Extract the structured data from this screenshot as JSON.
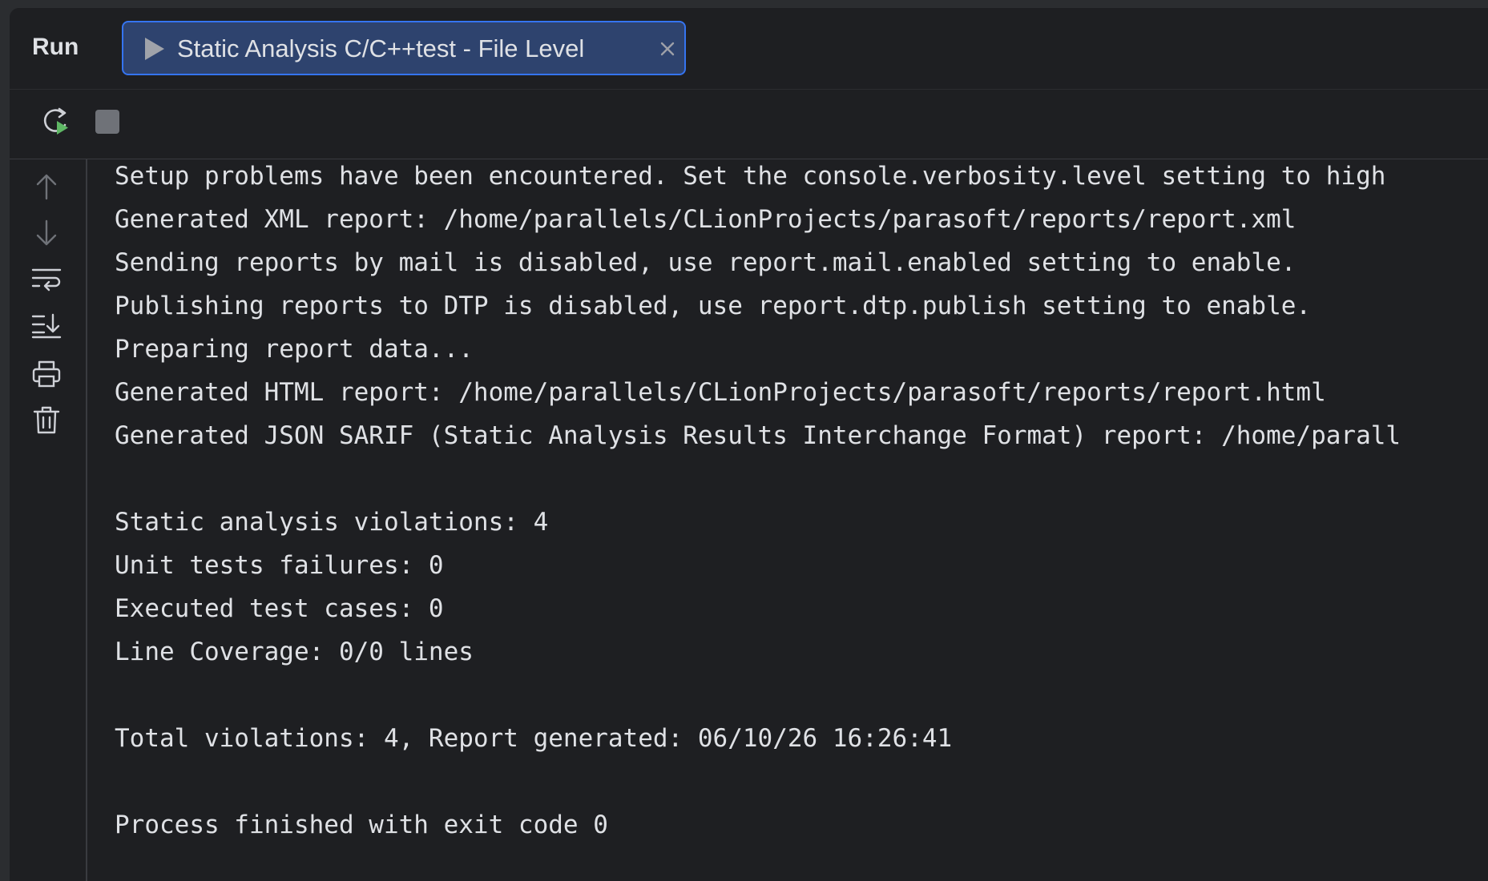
{
  "panel": {
    "title": "Run"
  },
  "tab": {
    "label": "Static Analysis C/C++test - File Level",
    "icon": "play-icon",
    "close_icon": "close-icon"
  },
  "toolbar": {
    "buttons": [
      {
        "name": "rerun",
        "icon": "rerun-icon"
      },
      {
        "name": "stop",
        "icon": "stop-icon"
      }
    ]
  },
  "sidebar": {
    "buttons": [
      {
        "name": "scroll-up",
        "icon": "arrow-up-icon"
      },
      {
        "name": "scroll-down",
        "icon": "arrow-down-icon"
      },
      {
        "name": "soft-wrap",
        "icon": "soft-wrap-icon"
      },
      {
        "name": "scroll-to-end",
        "icon": "scroll-to-end-icon"
      },
      {
        "name": "print",
        "icon": "print-icon"
      },
      {
        "name": "clear-all",
        "icon": "trash-icon"
      }
    ]
  },
  "console": {
    "lines": [
      "Setup problems have been encountered. Set the console.verbosity.level setting to high",
      "Generated XML report: /home/parallels/CLionProjects/parasoft/reports/report.xml",
      "Sending reports by mail is disabled, use report.mail.enabled setting to enable.",
      "Publishing reports to DTP is disabled, use report.dtp.publish setting to enable.",
      "Preparing report data...",
      "Generated HTML report: /home/parallels/CLionProjects/parasoft/reports/report.html",
      "Generated JSON SARIF (Static Analysis Results Interchange Format) report: /home/parall",
      "",
      "Static analysis violations: 4",
      "Unit tests failures: 0",
      "Executed test cases: 0",
      "Line Coverage: 0/0 lines",
      "",
      "Total violations: 4, Report generated: 06/10/26 16:26:41",
      "",
      "Process finished with exit code 0"
    ]
  },
  "colors": {
    "background": "#1e1f22",
    "frame": "#2b2d30",
    "tab_fill": "#2e436e",
    "tab_border": "#3574f0",
    "text": "#dfe1e5",
    "icon": "#ced0d6",
    "run_green": "#5fb865"
  }
}
